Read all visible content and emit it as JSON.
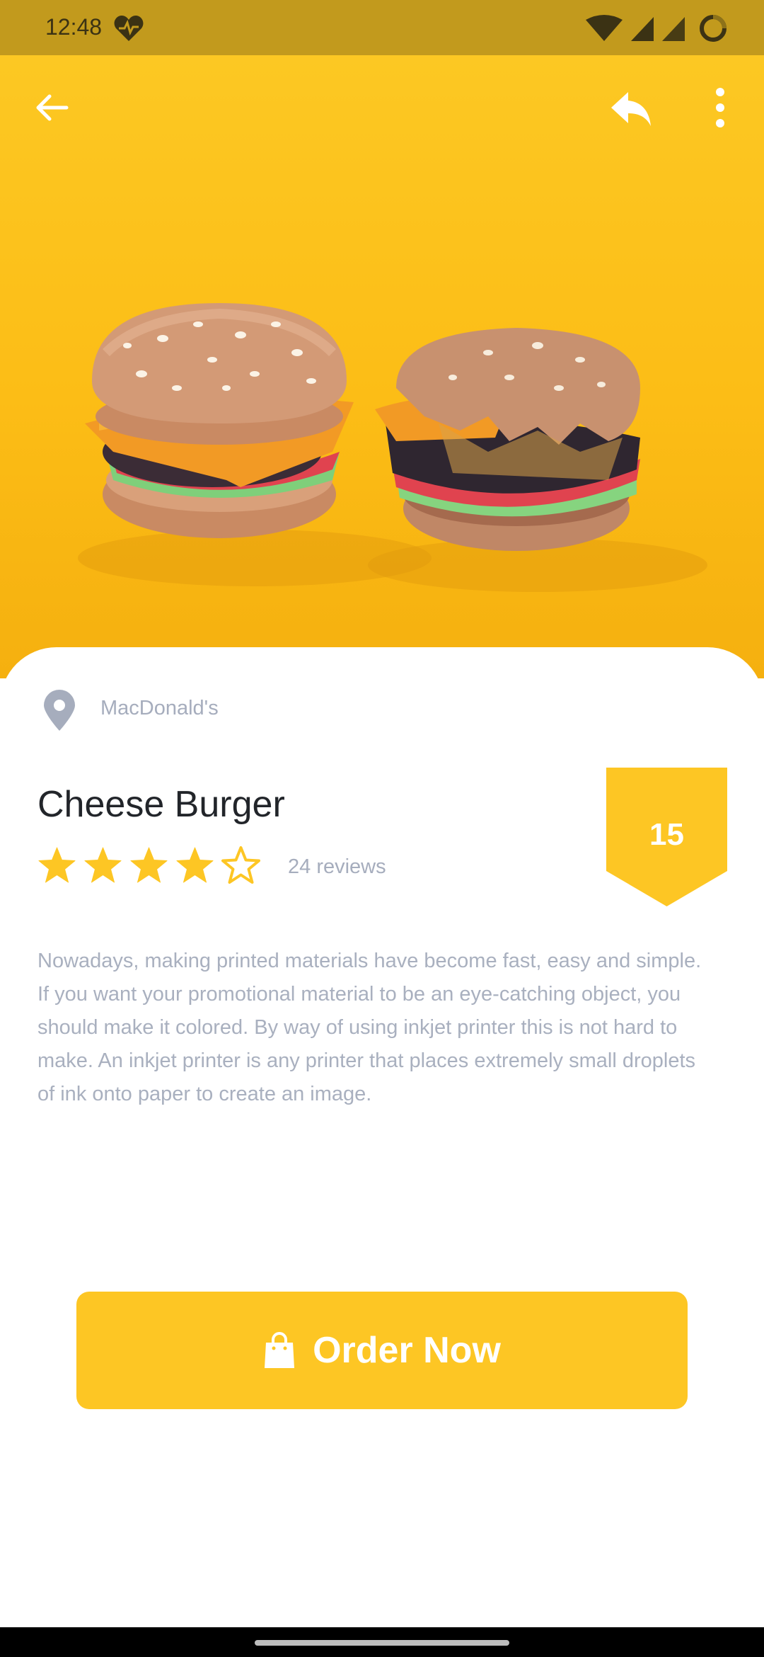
{
  "status_bar": {
    "time": "12:48",
    "icons": [
      "heart-icon",
      "wifi-icon",
      "signal-icon",
      "signal-icon",
      "battery-ring-icon"
    ]
  },
  "header": {
    "back_icon": "arrow-left-icon",
    "share_icon": "reply-icon",
    "more_icon": "more-vertical-icon"
  },
  "product": {
    "location_icon": "map-pin-icon",
    "location": "MacDonald's",
    "title": "Cheese Burger",
    "rating": 4,
    "rating_max": 5,
    "reviews": "24 reviews",
    "badge": "15",
    "description": "Nowadays, making printed materials have become fast, easy and simple. If you want your promotional material to be an eye-catching object, you should make it colored. By way of using inkjet printer this is not hard to make. An inkjet printer is any printer that places extremely small droplets of ink onto paper to create an image."
  },
  "action": {
    "order_label": "Order Now",
    "order_icon": "shopping-bag-icon"
  },
  "colors": {
    "accent": "#fdc624",
    "status_bar": "#c29a1d",
    "muted_text": "#a6adbd",
    "title_text": "#22252a"
  }
}
